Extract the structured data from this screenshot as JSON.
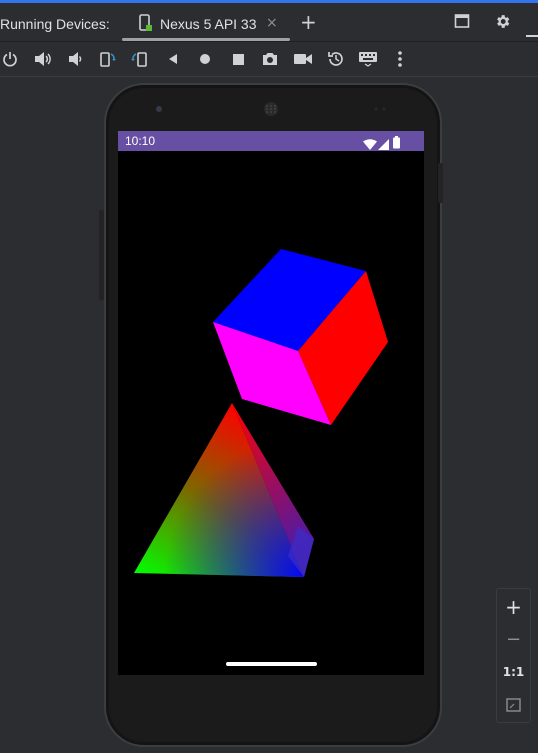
{
  "panel": {
    "title": "Running Devices:"
  },
  "tabs": [
    {
      "label": "Nexus 5 API 33",
      "close": "×"
    }
  ],
  "new_tab": "+",
  "toolbar": {
    "icons": [
      "power-icon",
      "volume-up-icon",
      "volume-down-icon",
      "rotate-left-icon",
      "rotate-right-icon",
      "back-icon",
      "home-icon",
      "overview-icon",
      "screenshot-icon",
      "screen-record-icon",
      "snapshot-icon",
      "keyboard-icon",
      "more-icon"
    ]
  },
  "device": {
    "status_time": "10:10",
    "status_bar_color": "#6750a4",
    "shapes": [
      "cube",
      "pyramid"
    ]
  },
  "zoom": {
    "in": "+",
    "out": "−",
    "actual": "1:1"
  },
  "colors": {
    "accent": "#3574f0",
    "background": "#2b2d30"
  }
}
